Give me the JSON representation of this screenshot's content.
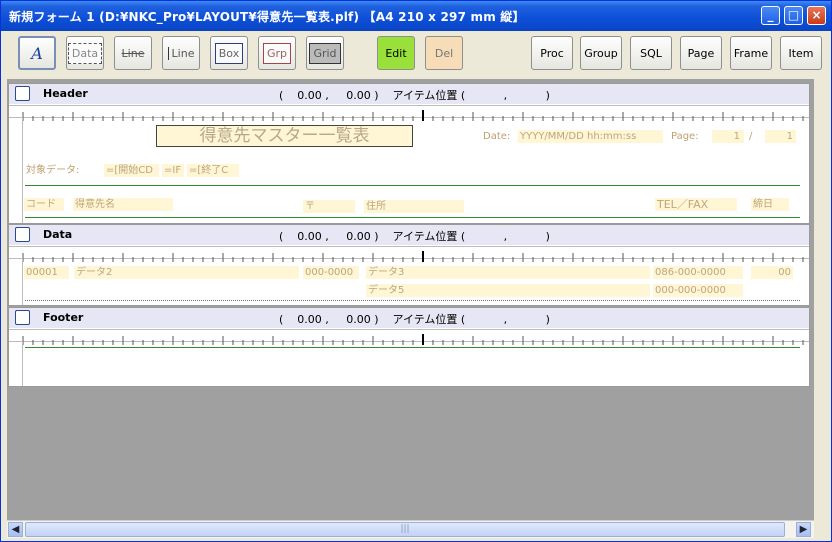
{
  "window": {
    "title": "新規フォーム 1 (D:¥NKC_Pro¥LAYOUT¥得意先一覧表.plf) 【A4 210 x 297 mm  縦】",
    "minimize_icon": "minimize-icon",
    "maximize_icon": "maximize-icon",
    "close_icon": "close-icon"
  },
  "toolbar": {
    "left_tools": [
      {
        "id": "label",
        "label": "Label"
      },
      {
        "id": "data",
        "label": "Data"
      },
      {
        "id": "line",
        "label": "Line"
      },
      {
        "id": "vline",
        "label": "Line"
      },
      {
        "id": "box",
        "label": "Box"
      },
      {
        "id": "grp",
        "label": "Grp"
      },
      {
        "id": "grid",
        "label": "Grid"
      }
    ],
    "edit_label": "Edit",
    "del_label": "Del",
    "right_buttons": [
      {
        "id": "proc",
        "label": "Proc"
      },
      {
        "id": "group",
        "label": "Group"
      },
      {
        "id": "sql",
        "label": "SQL"
      },
      {
        "id": "page",
        "label": "Page"
      },
      {
        "id": "frame",
        "label": "Frame"
      },
      {
        "id": "item",
        "label": "Item"
      }
    ],
    "edit_color": "#99e03a",
    "del_color": "#f6dcb7"
  },
  "sections": {
    "header": {
      "name": "Header",
      "coord": "(    0.00 ,     0.00 )    アイテム位置 (           ,           )",
      "title": "得意先マスター一覧表",
      "date_label": "Date:",
      "date_value": "YYYY/MM/DD  hh:mm:ss",
      "page_label": "Page:",
      "page_value": "1",
      "page_sep": "/",
      "page_total": "1",
      "target_label": "対象データ:",
      "target_start": "=[開始CD",
      "target_if": "=IF",
      "target_end": "=[終了C",
      "col_code": "コード",
      "col_name": "得意先名",
      "col_zip": "〒",
      "col_addr": "住所",
      "col_tel": "TEL／FAX",
      "col_close": "締日"
    },
    "data": {
      "name": "Data",
      "coord": "(    0.00 ,     0.00 )    アイテム位置 (           ,           )",
      "code": "00001",
      "name2": "データ2",
      "zip": "000-0000",
      "addr3": "データ3",
      "tel": "086-000-0000",
      "close": "00",
      "addr5": "データ5",
      "fax": "000-000-0000"
    },
    "footer": {
      "name": "Footer",
      "coord": "(    0.00 ,     0.00 )    アイテム位置 (           ,           )"
    }
  },
  "scrollbar": {
    "left_icon": "scroll-left-icon",
    "right_icon": "scroll-right-icon",
    "grip": "|||"
  }
}
